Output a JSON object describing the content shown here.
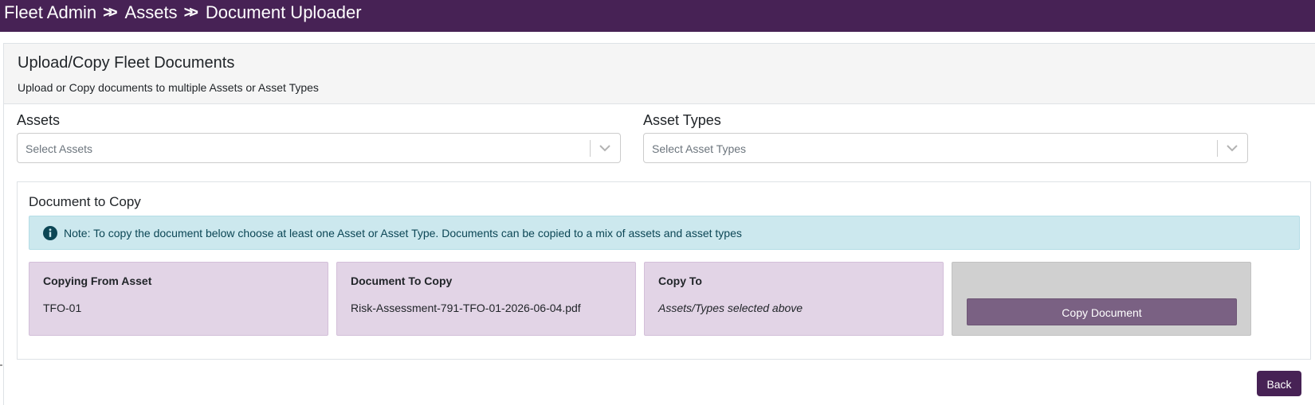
{
  "header": {
    "breadcrumb": [
      "Fleet Admin",
      "Assets",
      "Document Uploader"
    ],
    "separator": ">>"
  },
  "page": {
    "title": "Upload/Copy Fleet Documents",
    "subtitle": "Upload or Copy documents to multiple Assets or Asset Types"
  },
  "assets": {
    "label": "Assets",
    "placeholder": "Select Assets"
  },
  "asset_types": {
    "label": "Asset Types",
    "placeholder": "Select Asset Types"
  },
  "copy_section": {
    "title": "Document to Copy",
    "note": "Note: To copy the document below choose at least one Asset or Asset Type. Documents can be copied to a mix of assets and asset types",
    "copying_from": {
      "title": "Copying From Asset",
      "value": "TFO-01"
    },
    "document": {
      "title": "Document To Copy",
      "value": "Risk-Assessment-791-TFO-01-2026-06-04.pdf"
    },
    "copy_to": {
      "title": "Copy To",
      "value": "Assets/Types selected above"
    },
    "copy_button": "Copy Document"
  },
  "footer": {
    "back_button": "Back"
  },
  "colors": {
    "brand": "#472255",
    "info_bg": "#cce8ee",
    "panel_bg": "#e2d4e6",
    "button": "#7a6183"
  },
  "icons": {
    "info": "info-circle-icon",
    "select_arrow": "chevron-down-icon"
  }
}
